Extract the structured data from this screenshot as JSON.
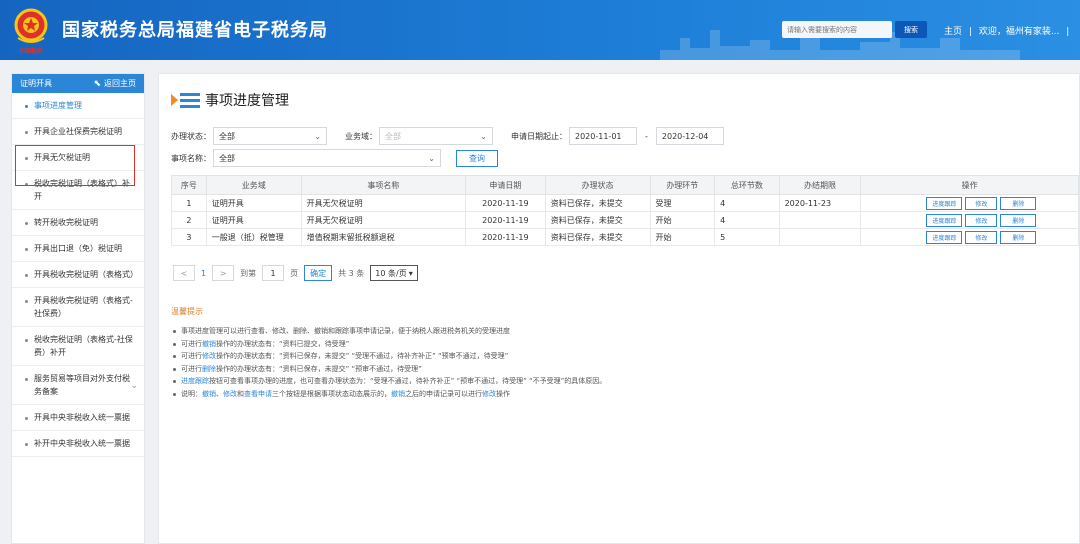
{
  "header": {
    "site_title": "国家税务总局福建省电子税务局",
    "emblem_caption": "中国税务",
    "search_placeholder": "请输入需要搜索的内容",
    "search_button": "搜索",
    "home_link": "主页",
    "separator": "|",
    "welcome_text": "欢迎，福州有家装...",
    "trailing_separator": "|",
    "colors": {
      "bar": "#1e7fd8",
      "search_button": "#0d57b8"
    }
  },
  "sidebar": {
    "title": "证明开具",
    "back_label": "返回主页",
    "items": [
      {
        "label": "事项进度管理",
        "active": true
      },
      {
        "label": "开具企业社保费完税证明"
      },
      {
        "label": "开具无欠税证明",
        "highlighted": true
      },
      {
        "label": "税收完税证明（表格式）补开"
      },
      {
        "label": "转开税收完税证明"
      },
      {
        "label": "开具出口退（免）税证明"
      },
      {
        "label": "开具税收完税证明（表格式）"
      },
      {
        "label": "开具税收完税证明（表格式-社保费）"
      },
      {
        "label": "税收完税证明（表格式-社保费）补开"
      },
      {
        "label": "服务贸易等项目对外支付税务备案",
        "has_chevron": true
      },
      {
        "label": "开具中央非税收入统一票据"
      },
      {
        "label": "补开中央非税收入统一票据"
      }
    ]
  },
  "main": {
    "page_title": "事项进度管理",
    "filters": {
      "status_label": "办理状态：",
      "status_value": "全部",
      "domain_label": "业务域：",
      "domain_value": "全部",
      "date_label": "申请日期起止：",
      "date_from": "2020-11-01",
      "date_sep": "-",
      "date_to": "2020-12-04",
      "item_label": "事项名称：",
      "item_value": "全部",
      "query_button": "查询"
    },
    "table": {
      "headers": [
        "序号",
        "业务域",
        "事项名称",
        "申请日期",
        "办理状态",
        "办理环节",
        "总环节数",
        "办结期限",
        "操作"
      ],
      "rows": [
        {
          "no": "1",
          "domain": "证明开具",
          "name": "开具无欠税证明",
          "date": "2020-11-19",
          "status": "资料已保存，未提交",
          "stage": "受理",
          "total": "4",
          "deadline": "2020-11-23"
        },
        {
          "no": "2",
          "domain": "证明开具",
          "name": "开具无欠税证明",
          "date": "2020-11-19",
          "status": "资料已保存，未提交",
          "stage": "开始",
          "total": "4",
          "deadline": ""
        },
        {
          "no": "3",
          "domain": "一般退（抵）税管理",
          "name": "增值税期末留抵税额退税",
          "date": "2020-11-19",
          "status": "资料已保存，未提交",
          "stage": "开始",
          "total": "5",
          "deadline": ""
        }
      ],
      "op_labels": {
        "track": "进度跟踪",
        "edit": "修改",
        "delete": "删除"
      }
    },
    "pagination": {
      "prev": "<",
      "current_page": "1",
      "next": ">",
      "goto_label": "到第",
      "goto_value": "1",
      "page_suffix": "页",
      "confirm": "确定",
      "total_text": "共 3 条",
      "page_size": "10 条/页"
    },
    "tips": {
      "title": "温馨提示",
      "items": [
        {
          "segments": [
            {
              "text": "事项进度管理可以进行查看、修改、删除、撤销和跟踪事项申请记录，便于纳税人跟进税务机关的受理进度"
            }
          ]
        },
        {
          "segments": [
            {
              "text": "可进行"
            },
            {
              "text": "撤销",
              "link": true
            },
            {
              "text": "操作的办理状态有：“资料已提交，待受理”"
            }
          ]
        },
        {
          "segments": [
            {
              "text": "可进行"
            },
            {
              "text": "修改",
              "link": true
            },
            {
              "text": "操作的办理状态有：“资料已保存，未提交”  “受理不通过，待补齐补正”  “预审不通过，待受理”"
            }
          ]
        },
        {
          "segments": [
            {
              "text": "可进行"
            },
            {
              "text": "删除",
              "link": true
            },
            {
              "text": "操作的办理状态有：“资料已保存，未提交”  “预审不通过，待受理”"
            }
          ]
        },
        {
          "segments": [
            {
              "text": "进度跟踪",
              "link": true
            },
            {
              "text": "按钮可查看事项办理的进度，也可查看办理状态为：“受理不通过，待补齐补正”  “预审不通过，待受理”  “不予受理”的具体原因。"
            }
          ]
        },
        {
          "segments": [
            {
              "text": "说明："
            },
            {
              "text": "撤销",
              "link": true
            },
            {
              "text": "、"
            },
            {
              "text": "修改",
              "link": true
            },
            {
              "text": "和"
            },
            {
              "text": "查看申请",
              "link": true
            },
            {
              "text": "三个按钮是根据事项状态动态展示的，"
            },
            {
              "text": "撤销",
              "link": true
            },
            {
              "text": "之后的申请记录可以进行"
            },
            {
              "text": "修改",
              "link": true
            },
            {
              "text": "操作"
            }
          ]
        }
      ]
    },
    "colors": {
      "accent": "#2c86d8",
      "tips_title": "#e07a20",
      "highlight_box": "#e0302a"
    }
  }
}
